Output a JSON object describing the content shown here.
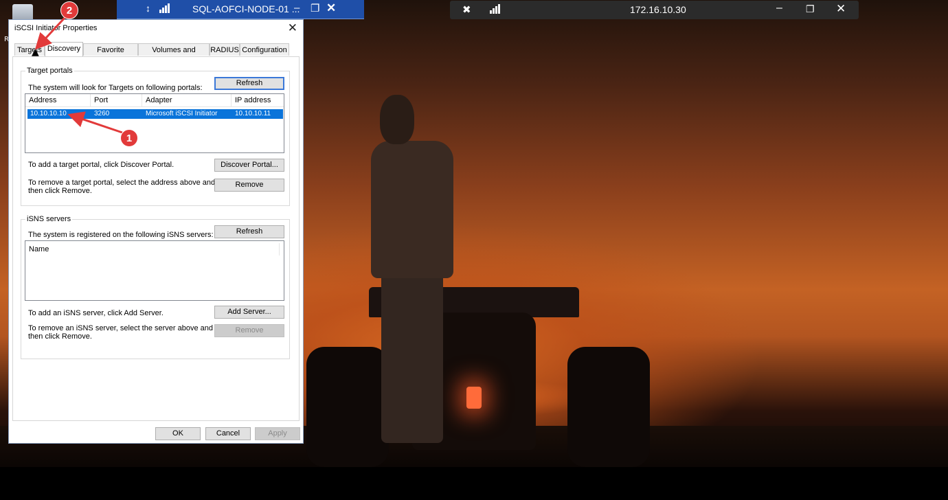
{
  "remote_bar_left": {
    "pin_icon": "pin-icon",
    "title": "SQL-AOFCI-NODE-01 ...",
    "minimize": "–",
    "restore": "❐",
    "close": "✕"
  },
  "remote_bar_right": {
    "pin_icon": "unpin-icon",
    "ip": "172.16.10.30",
    "minimize": "–",
    "restore": "❐",
    "close": "✕"
  },
  "desktop": {
    "icon_label": "R"
  },
  "dialog": {
    "title": "iSCSI Initiator Properties",
    "close": "✕",
    "tabs": [
      {
        "label": "Targets"
      },
      {
        "label": "Discovery"
      },
      {
        "label": "Favorite Targets"
      },
      {
        "label": "Volumes and Devices"
      },
      {
        "label": "RADIUS"
      },
      {
        "label": "Configuration"
      }
    ],
    "active_tab": "Discovery",
    "target_portals": {
      "group_label": "Target portals",
      "description": "The system will look for Targets on following portals:",
      "refresh": "Refresh",
      "columns": [
        "Address",
        "Port",
        "Adapter",
        "IP address"
      ],
      "rows": [
        {
          "address": "10.10.10.10",
          "port": "3260",
          "adapter": "Microsoft iSCSI Initiator",
          "ip": "10.10.10.11"
        }
      ],
      "add_text": "To add a target portal, click Discover Portal.",
      "discover_button": "Discover Portal...",
      "remove_text_1": "To remove a target portal, select the address above and",
      "remove_text_2": "then click Remove.",
      "remove_button": "Remove"
    },
    "isns_servers": {
      "group_label": "iSNS servers",
      "description": "The system is registered on the following iSNS servers:",
      "refresh": "Refresh",
      "columns": [
        "Name"
      ],
      "add_text": "To add an iSNS server, click Add Server.",
      "add_button": "Add Server...",
      "remove_text_1": "To remove an iSNS server, select the server above and",
      "remove_text_2": "then click Remove.",
      "remove_button": "Remove"
    },
    "footer": {
      "ok": "OK",
      "cancel": "Cancel",
      "apply": "Apply"
    }
  },
  "annotations": {
    "badge_1": "1",
    "badge_2": "2",
    "color": "#e23a3a"
  }
}
